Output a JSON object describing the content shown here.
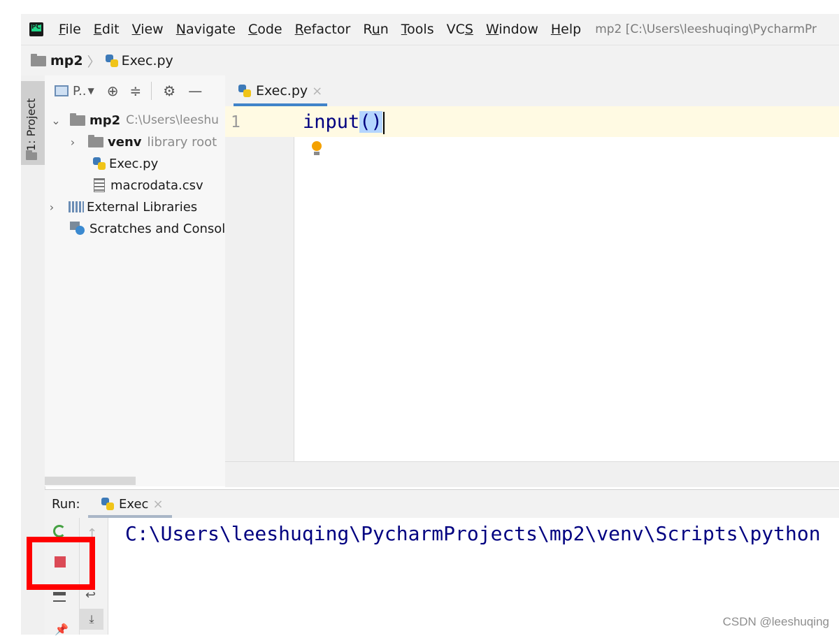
{
  "menu": {
    "items": [
      {
        "label": "File",
        "underline": "F",
        "rest": "ile"
      },
      {
        "label": "Edit",
        "underline": "E",
        "rest": "dit"
      },
      {
        "label": "View",
        "underline": "V",
        "rest": "iew"
      },
      {
        "label": "Navigate",
        "underline": "N",
        "rest": "avigate"
      },
      {
        "label": "Code",
        "underline": "C",
        "rest": "ode"
      },
      {
        "label": "Refactor",
        "underline": "R",
        "rest": "efactor"
      },
      {
        "label": "Run",
        "pre": "R",
        "underline": "u",
        "rest": "n"
      },
      {
        "label": "Tools",
        "underline": "T",
        "rest": "ools"
      },
      {
        "label": "VCS",
        "pre": "VC",
        "underline": "S",
        "rest": ""
      },
      {
        "label": "Window",
        "underline": "W",
        "rest": "indow"
      },
      {
        "label": "Help",
        "underline": "H",
        "rest": "elp"
      }
    ],
    "window_title": "mp2 [C:\\Users\\leeshuqing\\PycharmPr"
  },
  "breadcrumb": {
    "project": "mp2",
    "separator": "〉",
    "file": "Exec.py"
  },
  "stripe": {
    "project_label": "1: Project"
  },
  "project_panel": {
    "view_label": "P..",
    "tree": {
      "root": {
        "name": "mp2",
        "path": "C:\\Users\\leeshu"
      },
      "venv": {
        "name": "venv",
        "note": "library root"
      },
      "exec": "Exec.py",
      "csv": "macrodata.csv",
      "external": "External Libraries",
      "scratches": "Scratches and Consol"
    }
  },
  "editor": {
    "tab_label": "Exec.py",
    "close_glyph": "×",
    "line_number": "1",
    "code_before": "input",
    "code_selected": "()"
  },
  "run_panel": {
    "label": "Run:",
    "tab_label": "Exec",
    "close_glyph": "×",
    "console_output": "C:\\Users\\leeshuqing\\PycharmProjects\\mp2\\venv\\Scripts\\python"
  },
  "watermark": "CSDN @leeshuqing",
  "colors": {
    "accent_tab": "#4083c9",
    "stop_red": "#db4a56",
    "highlight_box": "#ff0000",
    "code_blue": "#000080"
  }
}
